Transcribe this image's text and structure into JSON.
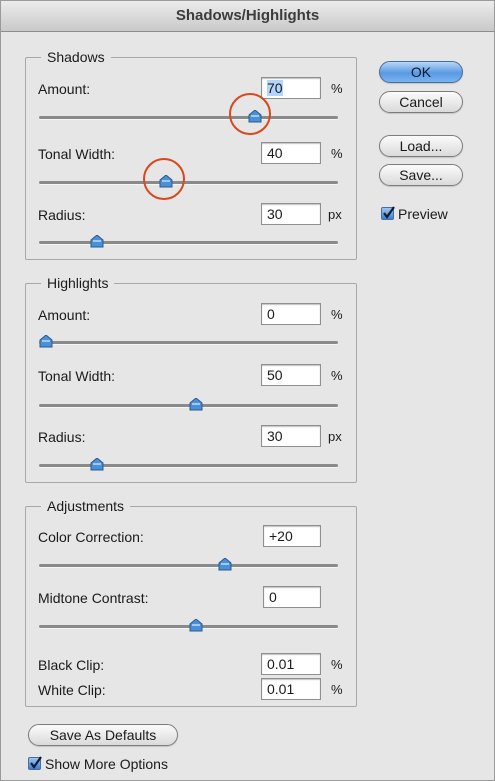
{
  "window": {
    "title": "Shadows/Highlights"
  },
  "shadows": {
    "legend": "Shadows",
    "amount": {
      "label": "Amount:",
      "value": "70",
      "unit": "%",
      "level": 0.7
    },
    "tonal_width": {
      "label": "Tonal Width:",
      "value": "40",
      "unit": "%",
      "level": 0.4
    },
    "radius": {
      "label": "Radius:",
      "value": "30",
      "unit": "px",
      "level": 0.17
    }
  },
  "highlights": {
    "legend": "Highlights",
    "amount": {
      "label": "Amount:",
      "value": "0",
      "unit": "%",
      "level": 0.0
    },
    "tonal_width": {
      "label": "Tonal Width:",
      "value": "50",
      "unit": "%",
      "level": 0.5
    },
    "radius": {
      "label": "Radius:",
      "value": "30",
      "unit": "px",
      "level": 0.17
    }
  },
  "adjustments": {
    "legend": "Adjustments",
    "color_correction": {
      "label": "Color Correction:",
      "value": "+20",
      "level": 0.6
    },
    "midtone_contrast": {
      "label": "Midtone Contrast:",
      "value": "0",
      "level": 0.5
    },
    "black_clip": {
      "label": "Black Clip:",
      "value": "0.01",
      "unit": "%"
    },
    "white_clip": {
      "label": "White Clip:",
      "value": "0.01",
      "unit": "%"
    }
  },
  "buttons": {
    "ok": "OK",
    "cancel": "Cancel",
    "load": "Load...",
    "save": "Save...",
    "save_defaults": "Save As Defaults"
  },
  "preview": {
    "label": "Preview",
    "checked": true
  },
  "show_more": {
    "label": "Show More Options",
    "checked": true
  },
  "colors": {
    "accent": "#5a9ae3",
    "highlight_ring": "#d9481c",
    "thumb": "#4a90d9"
  },
  "icons": {
    "slider_thumb": "slider-thumb-icon",
    "checkmark": "checkmark-icon"
  }
}
